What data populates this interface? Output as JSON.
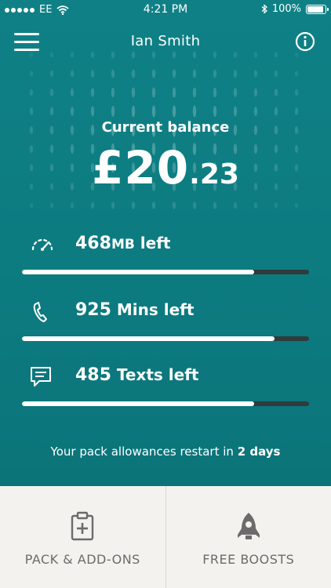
{
  "status_bar": {
    "carrier": "EE",
    "time": "4:21 PM",
    "battery": "100%"
  },
  "header": {
    "title": "Ian Smith"
  },
  "balance": {
    "label": "Current balance",
    "amount_main": "£20",
    "amount_decimal": ".23"
  },
  "allowances": [
    {
      "icon": "speedometer-icon",
      "number": "468",
      "unit": "MB",
      "suffix": " left",
      "fraction_remaining": 0.81
    },
    {
      "icon": "phone-icon",
      "number": "925",
      "unit": "",
      "suffix": " Mins left",
      "fraction_remaining": 0.88
    },
    {
      "icon": "message-icon",
      "number": "485",
      "unit": "",
      "suffix": " Texts left",
      "fraction_remaining": 0.81
    }
  ],
  "restart_note": {
    "prefix": "Your pack allowances restart in ",
    "emphasis": "2 days"
  },
  "tabs": [
    {
      "label": "PACK & ADD-ONS",
      "icon": "pack-clipboard-icon"
    },
    {
      "label": "FREE BOOSTS",
      "icon": "rocket-icon"
    }
  ],
  "colors": {
    "primary": "#0f7f83",
    "bar_track": "#2f3b3d",
    "tabbar_bg": "#f4f2ee",
    "tab_text": "#6b6b6b"
  }
}
